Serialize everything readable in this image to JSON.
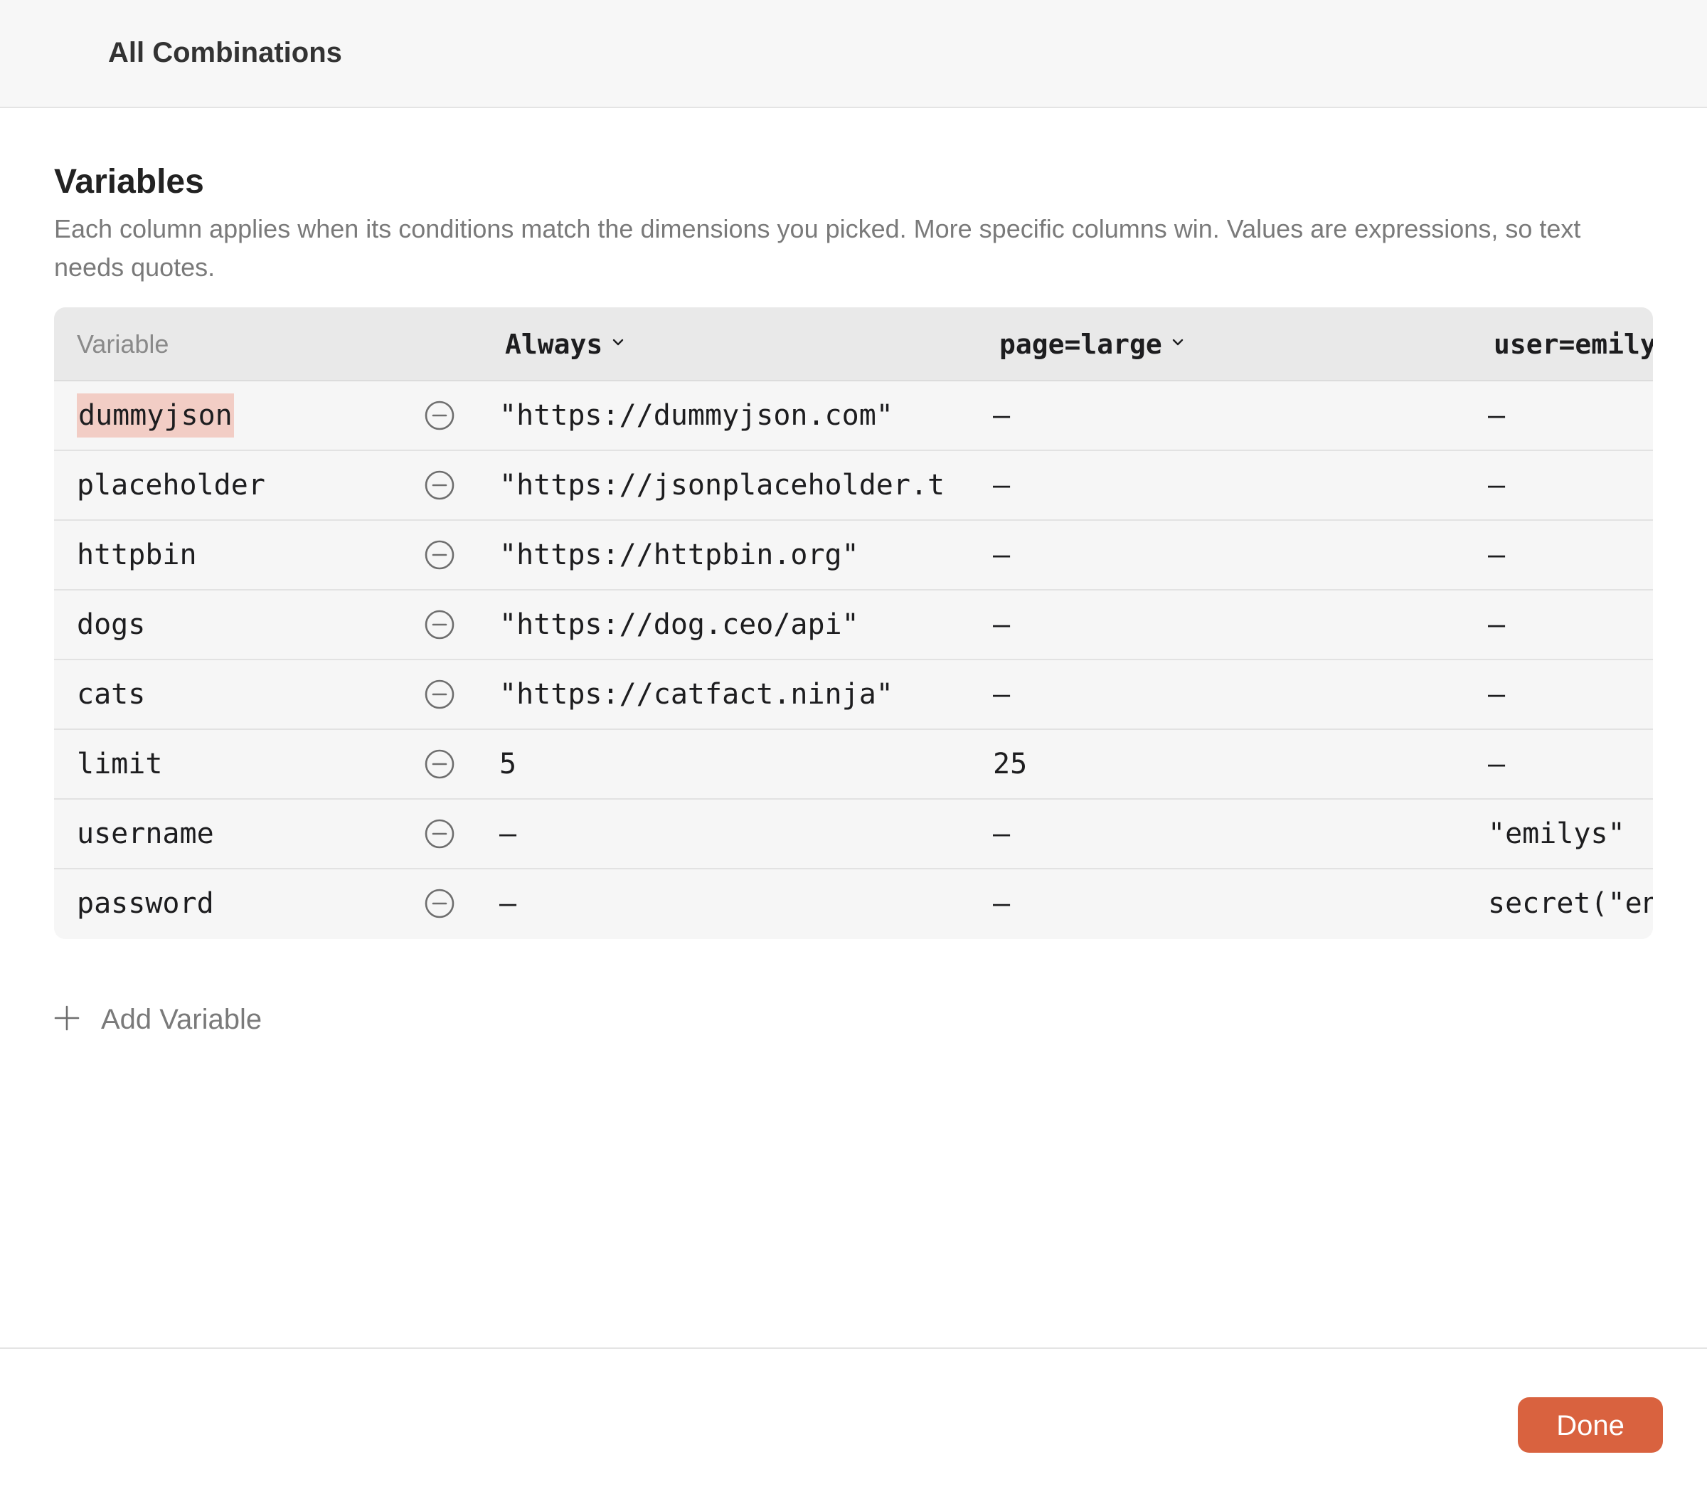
{
  "header": {
    "title": "All Combinations"
  },
  "section": {
    "title": "Variables",
    "description": "Each column applies when its conditions match the dimensions you picked. More specific columns win. Values are expressions, so text needs quotes."
  },
  "table": {
    "columns": {
      "variable": "Variable",
      "always": "Always",
      "page_large": "page=large",
      "user_emily": "user=emily"
    },
    "rows": [
      {
        "name": "dummyjson",
        "always": "\"https://dummyjson.com\"",
        "page_large": "—",
        "user_emily": "—"
      },
      {
        "name": "placeholder",
        "always": "\"https://jsonplaceholder.t",
        "page_large": "—",
        "user_emily": "—"
      },
      {
        "name": "httpbin",
        "always": "\"https://httpbin.org\"",
        "page_large": "—",
        "user_emily": "—"
      },
      {
        "name": "dogs",
        "always": "\"https://dog.ceo/api\"",
        "page_large": "—",
        "user_emily": "—"
      },
      {
        "name": "cats",
        "always": "\"https://catfact.ninja\"",
        "page_large": "—",
        "user_emily": "—"
      },
      {
        "name": "limit",
        "always": "5",
        "page_large": "25",
        "user_emily": "—"
      },
      {
        "name": "username",
        "always": "—",
        "page_large": "—",
        "user_emily": "\"emilys\""
      },
      {
        "name": "password",
        "always": "—",
        "page_large": "—",
        "user_emily": "secret(\"en"
      }
    ],
    "icons": {
      "remove": "minus-circle-icon",
      "column_menu": "chevron-down-icon"
    }
  },
  "add_variable": {
    "label": "Add Variable",
    "icon": "plus-icon"
  },
  "footer": {
    "done_label": "Done"
  },
  "colors": {
    "accent": "#d9623f",
    "highlight": "#f2cdc5",
    "header_bg": "#f7f7f7",
    "table_head_bg": "#e9e9e9",
    "row_bg": "#f6f6f6"
  }
}
